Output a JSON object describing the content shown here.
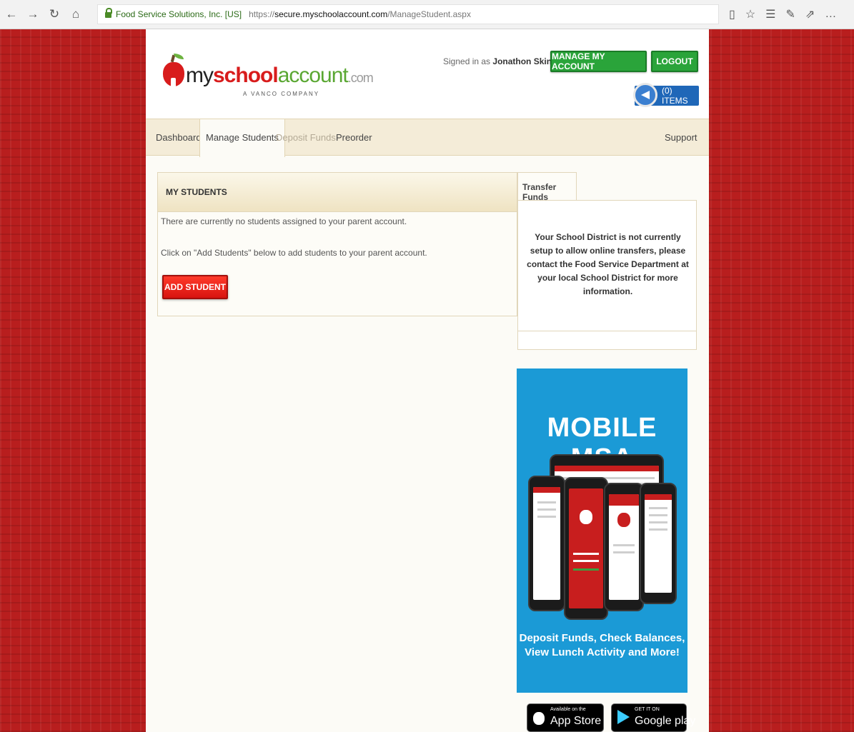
{
  "browser": {
    "site_identity": "Food Service Solutions, Inc. [US]",
    "url_prefix": "https://",
    "url_host": "secure.myschoolaccount.com",
    "url_path": "/ManageStudent.aspx",
    "nav_icons": [
      "back-arrow-icon",
      "forward-arrow-icon",
      "refresh-icon",
      "home-icon"
    ],
    "toolbar_icons": [
      "reading-view-icon",
      "favorite-star-icon",
      "favorites-hub-icon",
      "web-note-icon",
      "share-icon",
      "more-icon"
    ]
  },
  "header": {
    "logo": {
      "my": "my",
      "school": "school",
      "account": "account",
      "com": ".com",
      "tagline": "A VANCO COMPANY"
    },
    "signed_in_prefix": "Signed in as",
    "user_name": "Jonathon Skinner",
    "manage_account": "MANAGE MY ACCOUNT",
    "logout": "LOGOUT",
    "cart_label": "(0) ITEMS"
  },
  "nav": {
    "items": [
      {
        "label": "Dashboard"
      },
      {
        "label": "Manage Students"
      },
      {
        "label": "Deposit Funds"
      },
      {
        "label": "Preorder"
      }
    ],
    "support": "Support"
  },
  "students_panel": {
    "title": "MY STUDENTS",
    "message": "There are currently no students assigned to your parent account.",
    "instruction": "Click on \"Add Students\" below to add students to your parent account.",
    "add_button": "ADD STUDENT"
  },
  "transfer_panel": {
    "tab": "Transfer Funds",
    "message": "Your School District is not currently setup to allow online transfers, please contact the Food Service Department at your local School District for more information."
  },
  "ad": {
    "title": "MOBILE MSA",
    "caption_line1": "Deposit Funds, Check Balances,",
    "caption_line2": "View Lunch Activity and More!"
  },
  "stores": {
    "apple_small": "Available on the",
    "apple_big": "App Store",
    "google_small": "GET IT ON",
    "google_big": "Google play"
  },
  "colors": {
    "brand_red": "#d81c1c",
    "brand_green": "#5aa732",
    "button_green": "#2aa43a",
    "cart_blue": "#1f67b8",
    "ad_blue": "#1b9ad6"
  }
}
